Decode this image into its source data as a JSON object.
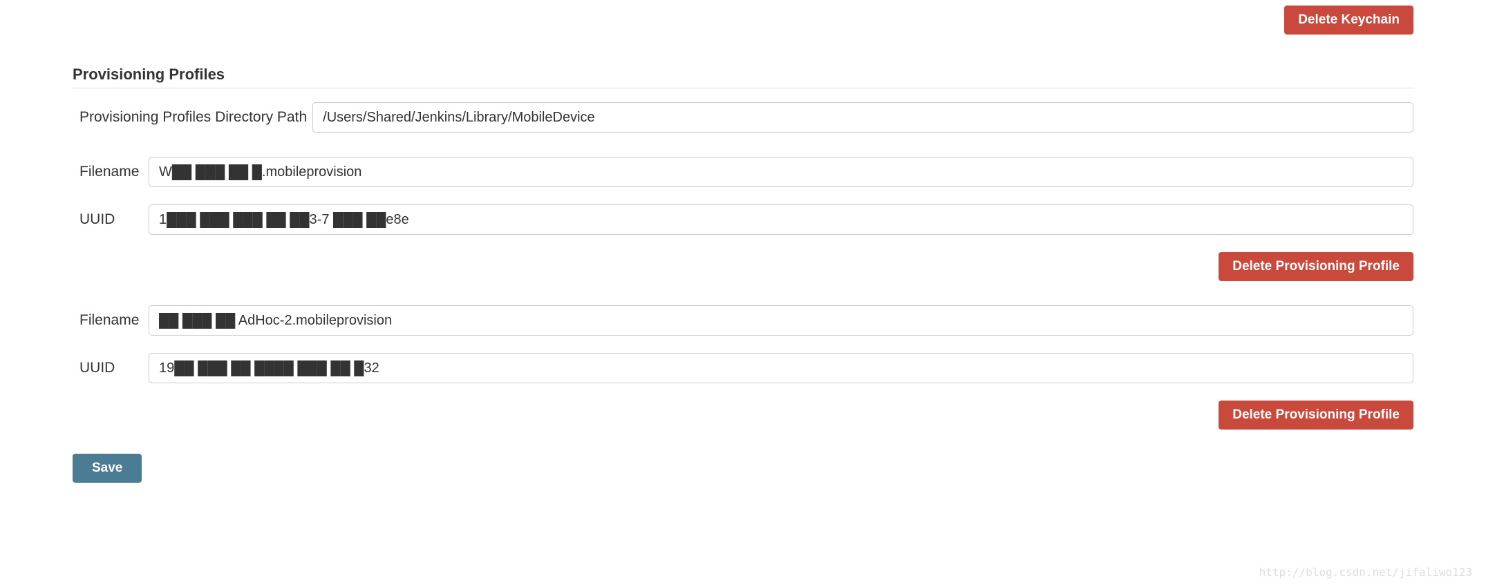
{
  "topActions": {
    "deleteKeychain": "Delete Keychain"
  },
  "section": {
    "heading": "Provisioning Profiles",
    "directoryLabel": "Provisioning Profiles Directory Path",
    "directoryValue": "/Users/Shared/Jenkins/Library/MobileDevice"
  },
  "labels": {
    "filename": "Filename",
    "uuid": "UUID",
    "deleteProfile": "Delete Provisioning Profile",
    "save": "Save"
  },
  "profiles": [
    {
      "filename": "W██ ███ ██ █.mobileprovision",
      "uuid": "1███ ███ ███ ██ ██3-7 ███ ██e8e"
    },
    {
      "filename": "██ ███ ██ AdHoc-2.mobileprovision",
      "uuid": "19██ ███ ██ ████ ███ ██ █32"
    }
  ],
  "watermark": "http://blog.csdn.net/jifaliwo123"
}
